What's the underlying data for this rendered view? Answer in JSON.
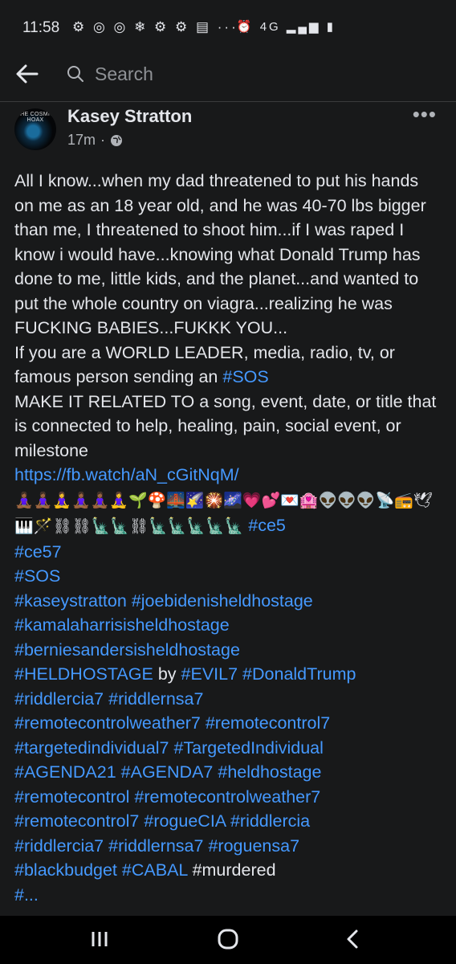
{
  "status_bar": {
    "time": "11:58",
    "icons_left": "⚙ ◎ ◎ ❄ ⚙ ⚙ ▤ ···",
    "icons_right": "⏰ 4G ▂▄▆ ▮"
  },
  "nav": {
    "search_placeholder": "Search"
  },
  "post": {
    "avatar_caption": "THE COSMIC HOAX",
    "author": "Kasey Stratton",
    "time": "17m",
    "text_main": "All I know...when my dad threatened to put his hands on me as an 18 year old, and he was 40-70 lbs bigger than me, I threatened to shoot him...if I was raped I know i would have...knowing what Donald Trump has done to me, little kids, and the planet...and wanted to put the whole country on viagra...realizing he was FUCKING BABIES...FUKKK YOU...",
    "text_leader": "If you are a WORLD LEADER, media, radio, tv, or famous person sending an ",
    "tag_sos": "#SOS",
    "text_related": "MAKE IT RELATED TO a song, event, date, or title that is connected to help, healing, pain, social event, or milestone",
    "link": "https://fb.watch/aN_cGitNqM/",
    "emojis": "🧘🏾‍♀️🧘🏾‍♀️🧘‍♀️🧘🏾‍♀️🧘🏾‍♀️🧘‍♀️🌱🍄🌉🌠🎇🌌💗💕💌🏩👽👽👽📡📻🕊🎹🪄⛓⛓🗽🗽⛓🗽🗽🗽🗽🗽",
    "hashtags": [
      "#ce5",
      "#ce57",
      "#SOS",
      "#kaseystratton",
      "#joebidenisheldhostage",
      "#kamalaharrisisheldhostage",
      "#berniesandersisheldhostage",
      "#HELDHOSTAGE"
    ],
    "word_by": "by",
    "hashtags2": [
      "#EVIL7",
      "#DonaldTrump",
      "#riddlercia7",
      "#riddlernsa7",
      "#remotecontrolweather7",
      "#remotecontrol7",
      "#targetedindividual7",
      "#TargetedIndividual",
      "#AGENDA21",
      "#AGENDA7",
      "#heldhostage",
      "#remotecontrol",
      "#remotecontrolweather7",
      "#remotecontrol7",
      "#rogueCIA",
      "#riddlercia",
      "#riddlercia7",
      "#riddlernsa7",
      "#roguensa7",
      "#blackbudget",
      "#CABAL"
    ],
    "word_murdered": "#murdered",
    "cut_line": "#..."
  },
  "system_nav": {
    "recents": "|||",
    "home": "◯",
    "back": "<"
  },
  "colors": {
    "background": "#18191a",
    "text": "#e4e6eb",
    "hashtag": "#4599ff",
    "muted": "#b0b3b8"
  }
}
